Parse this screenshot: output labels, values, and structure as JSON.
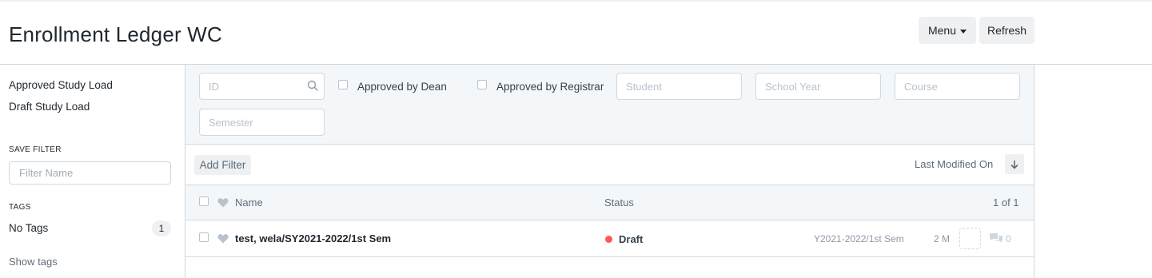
{
  "page": {
    "title": "Enrollment Ledger WC"
  },
  "header": {
    "menu_label": "Menu",
    "refresh_label": "Refresh"
  },
  "sidebar": {
    "links": [
      "Approved Study Load",
      "Draft Study Load"
    ],
    "save_filter_title": "SAVE FILTER",
    "filter_name_placeholder": "Filter Name",
    "tags_title": "TAGS",
    "tag_item": {
      "label": "No Tags",
      "count": "1"
    },
    "show_tags_label": "Show tags"
  },
  "filters": {
    "id_placeholder": "ID",
    "approved_by_dean": "Approved by Dean",
    "approved_by_registrar": "Approved by Registrar",
    "student_placeholder": "Student",
    "school_year_placeholder": "School Year",
    "course_placeholder": "Course",
    "semester_placeholder": "Semester"
  },
  "toolbar": {
    "add_filter_label": "Add Filter",
    "sort_label": "Last Modified On"
  },
  "list": {
    "col_name": "Name",
    "col_status": "Status",
    "page_count": "1 of 1",
    "rows": [
      {
        "name": "test, wela/SY2021-2022/1st Sem",
        "status": "Draft",
        "school_year": "Y2021-2022/1st Sem",
        "modified": "2 M",
        "comments": "0"
      }
    ]
  },
  "colors": {
    "status_draft": "#ff5858",
    "filter_bg": "#f4f7fa",
    "border": "#d1d8dd"
  }
}
